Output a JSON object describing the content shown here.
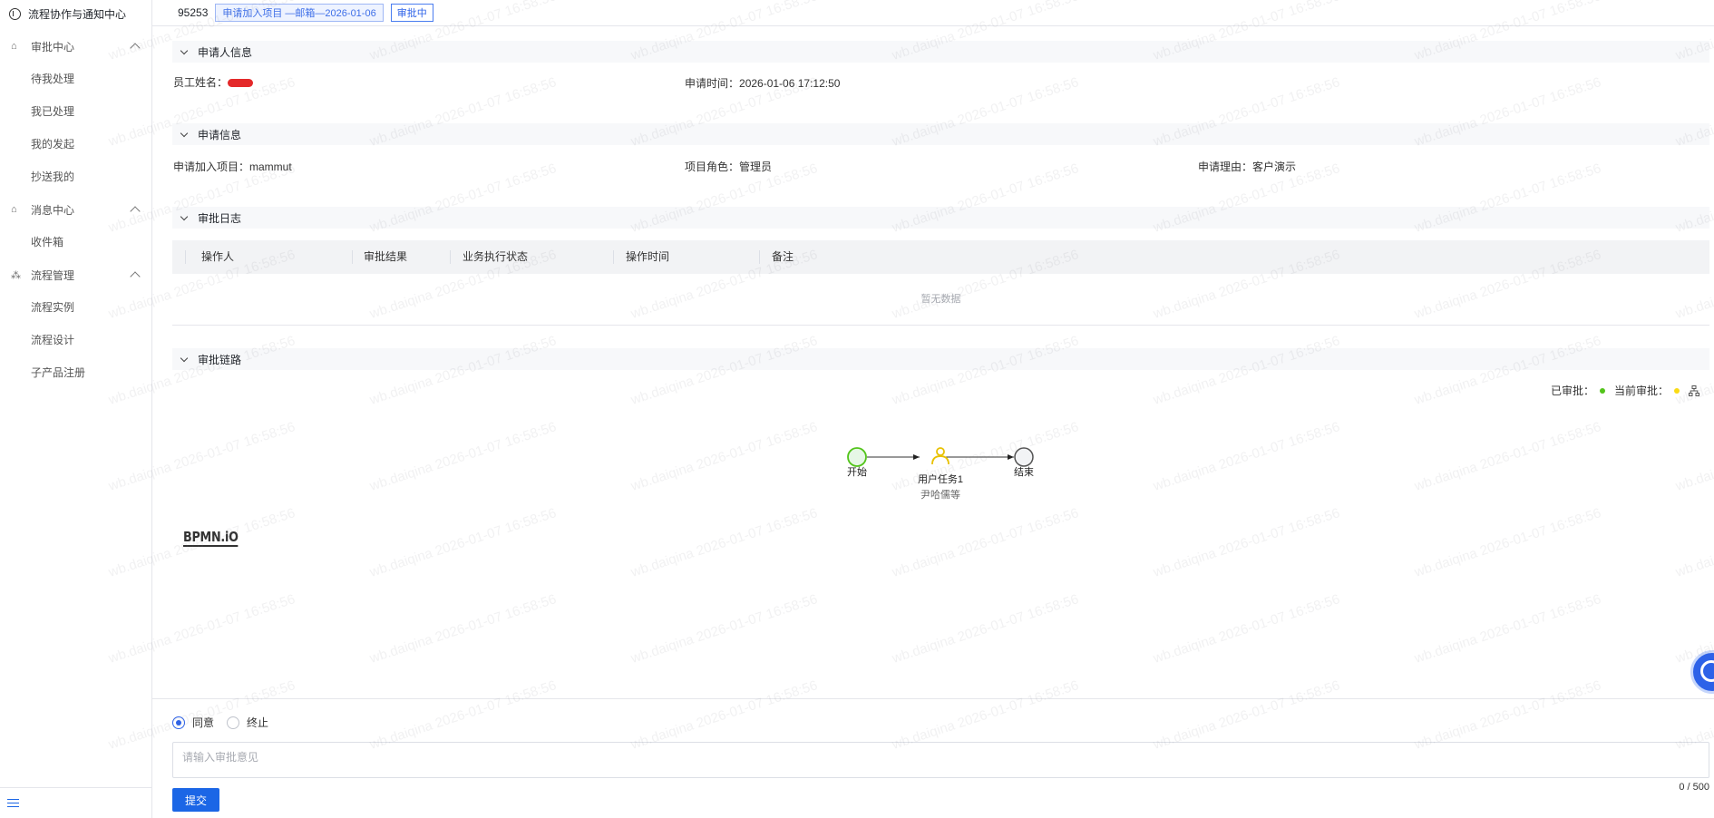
{
  "app": {
    "title": "流程协作与通知中心"
  },
  "sidebar": {
    "groups": [
      {
        "label": "审批中心",
        "items": [
          "待我处理",
          "我已处理",
          "我的发起",
          "抄送我的"
        ]
      },
      {
        "label": "消息中心",
        "items": [
          "收件箱"
        ]
      },
      {
        "label": "流程管理",
        "items": [
          "流程实例",
          "流程设计",
          "子产品注册"
        ]
      }
    ]
  },
  "header": {
    "id": "95253",
    "title_tag": "申请加入项目 —邮箱—2026-01-06",
    "status": "审批中"
  },
  "applicant": {
    "section_title": "申请人信息",
    "name_label": "员工姓名：",
    "time_label": "申请时间：",
    "time_value": "2026-01-06 17:12:50"
  },
  "application": {
    "section_title": "申请信息",
    "project_label": "申请加入项目：",
    "project_value": "mammut",
    "role_label": "项目角色：",
    "role_value": "管理员",
    "reason_label": "申请理由：",
    "reason_value": "客户演示"
  },
  "log": {
    "section_title": "审批日志",
    "columns": [
      "操作人",
      "审批结果",
      "业务执行状态",
      "操作时间",
      "备注"
    ],
    "empty_text": "暂无数据"
  },
  "chain": {
    "section_title": "审批链路",
    "legend_approved": "已审批：",
    "legend_current": "当前审批：",
    "approved_color": "#52c41a",
    "current_color": "#fadb14",
    "nodes": {
      "start": "开始",
      "task": "用户任务1",
      "task_assignee": "尹哈儒等",
      "end": "结束"
    },
    "logo": "BPMN.iO"
  },
  "approval": {
    "options": [
      "同意",
      "终止"
    ],
    "selected": "同意",
    "placeholder": "请输入审批意见",
    "counter": "0 / 500",
    "submit_label": "提交"
  },
  "watermark": {
    "text": "wb.daiqina 2026-01-07 16:58:56"
  }
}
